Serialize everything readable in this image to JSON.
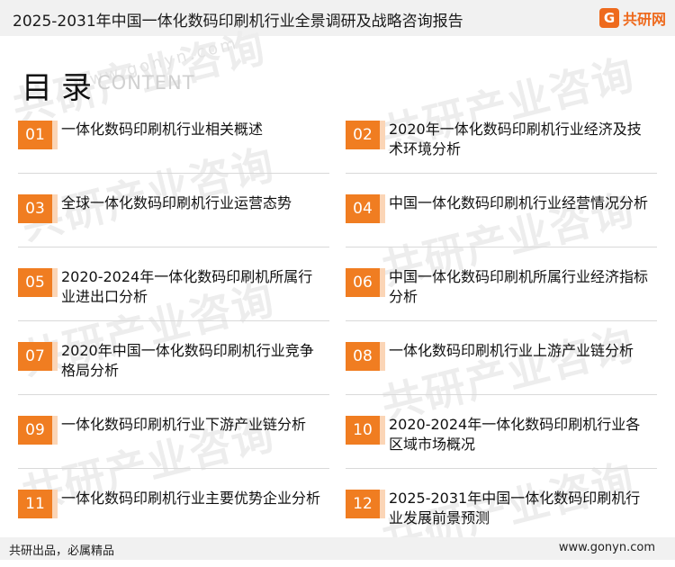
{
  "header": {
    "title": "2025-2031年中国一体化数码印刷机行业全景调研及战略咨询报告",
    "brand_name": "共研网",
    "brand_icon": "G"
  },
  "toc": {
    "heading": "目录",
    "subheading": "CONTENT",
    "items": [
      {
        "num": "01",
        "label": "一体化数码印刷机行业相关概述"
      },
      {
        "num": "02",
        "label": "2020年一体化数码印刷机行业经济及技术环境分析"
      },
      {
        "num": "03",
        "label": "全球一体化数码印刷机行业运营态势"
      },
      {
        "num": "04",
        "label": "中国一体化数码印刷机行业经营情况分析"
      },
      {
        "num": "05",
        "label": "2020-2024年一体化数码印刷机所属行业进出口分析"
      },
      {
        "num": "06",
        "label": "中国一体化数码印刷机所属行业经济指标分析"
      },
      {
        "num": "07",
        "label": "2020年中国一体化数码印刷机行业竞争格局分析"
      },
      {
        "num": "08",
        "label": "一体化数码印刷机行业上游产业链分析"
      },
      {
        "num": "09",
        "label": "一体化数码印刷机行业下游产业链分析"
      },
      {
        "num": "10",
        "label": "2020-2024年一体化数码印刷机行业各区域市场概况"
      },
      {
        "num": "11",
        "label": "一体化数码印刷机行业主要优势企业分析"
      },
      {
        "num": "12",
        "label": "2025-2031年中国一体化数码印刷机行业发展前景预测"
      }
    ]
  },
  "footer": {
    "slogan": "共研出品，必属精品",
    "url": "www.gonyn.com"
  },
  "watermark": {
    "text": "共研产业咨询",
    "sub": "www.gonyn.com"
  },
  "colors": {
    "accent": "#f07d21",
    "accent_light": "#fbd5b6",
    "brand": "#ee6a1d"
  }
}
